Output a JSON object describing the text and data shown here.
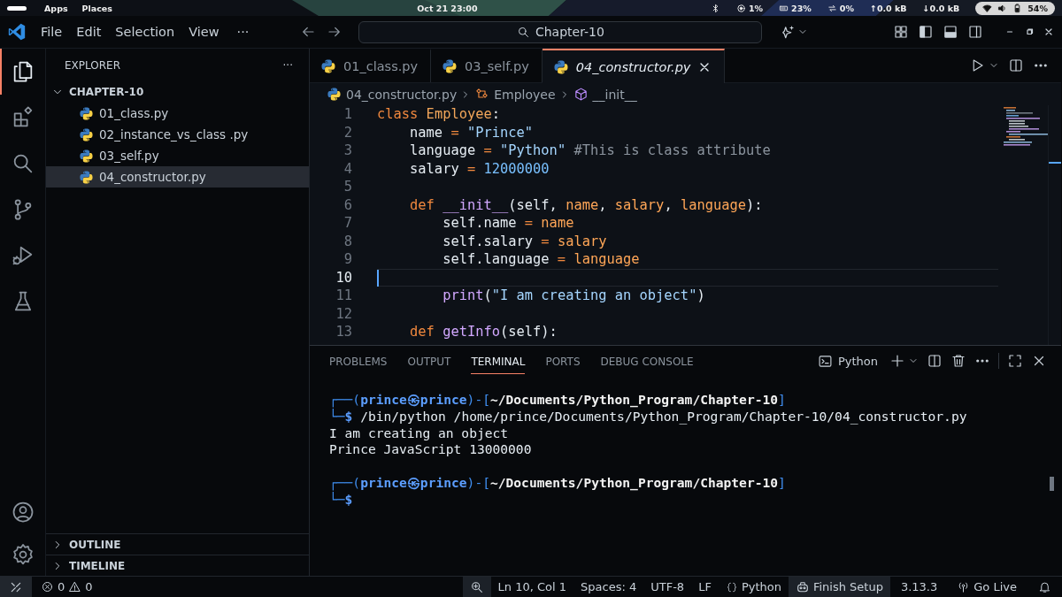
{
  "system_bar": {
    "menus": [
      "Apps",
      "Places"
    ],
    "clock": "Oct 21  23:00",
    "indicators": [
      {
        "kind": "cpu",
        "text": "1%"
      },
      {
        "kind": "memory",
        "text": "23%"
      },
      {
        "kind": "swap",
        "text": "0%"
      },
      {
        "kind": "plain",
        "text": "↑0.0 kB"
      },
      {
        "kind": "plain",
        "text": "↓0.0 kB"
      }
    ],
    "battery": "54%"
  },
  "title_bar": {
    "menus": [
      "File",
      "Edit",
      "Selection",
      "View"
    ],
    "more": "···",
    "search": {
      "value": "Chapter-10"
    }
  },
  "activity_bar": {
    "items": [
      {
        "kind": "explorer",
        "selected": true
      },
      {
        "kind": "extensions",
        "selected": false
      },
      {
        "kind": "search",
        "selected": false
      },
      {
        "kind": "source-control",
        "selected": false
      },
      {
        "kind": "run-debug",
        "selected": false
      },
      {
        "kind": "testing",
        "selected": false
      }
    ],
    "bottom": [
      {
        "kind": "account"
      },
      {
        "kind": "settings"
      }
    ]
  },
  "sidebar": {
    "title": "EXPLORER",
    "more": "···",
    "folder": {
      "label": "CHAPTER-10",
      "expanded": true,
      "children": [
        {
          "label": "01_class.py",
          "selected": false
        },
        {
          "label": "02_instance_vs_class .py",
          "selected": false
        },
        {
          "label": "03_self.py",
          "selected": false
        },
        {
          "label": "04_constructor.py",
          "selected": true
        }
      ]
    },
    "sections": [
      {
        "label": "OUTLINE",
        "expanded": false
      },
      {
        "label": "TIMELINE",
        "expanded": false
      }
    ]
  },
  "editor": {
    "tabs": [
      {
        "label": "01_class.py",
        "selected": false,
        "preview": false
      },
      {
        "label": "03_self.py",
        "selected": false,
        "preview": false
      },
      {
        "label": "04_constructor.py",
        "selected": true,
        "preview": true
      }
    ],
    "breadcrumb": [
      {
        "label": "04_constructor.py",
        "kind": "file"
      },
      {
        "label": "Employee",
        "kind": "class"
      },
      {
        "label": "__init__",
        "kind": "method"
      }
    ],
    "lines": [
      {
        "number": "1",
        "current": false,
        "tokens": [
          {
            "text": "class",
            "kind": "kw"
          },
          {
            "text": " Employee",
            "kind": "cls"
          },
          {
            "text": ":",
            "kind": "plain"
          }
        ]
      },
      {
        "number": "2",
        "current": false,
        "tokens": [
          {
            "text": "    name",
            "kind": "plain"
          },
          {
            "text": " = ",
            "kind": "op"
          },
          {
            "text": "\"Prince\"",
            "kind": "str"
          }
        ]
      },
      {
        "number": "3",
        "current": false,
        "tokens": [
          {
            "text": "    language",
            "kind": "plain"
          },
          {
            "text": " = ",
            "kind": "op"
          },
          {
            "text": "\"Python\"",
            "kind": "str"
          },
          {
            "text": " #This is class attribute",
            "kind": "cmt"
          }
        ]
      },
      {
        "number": "4",
        "current": false,
        "tokens": [
          {
            "text": "    salary",
            "kind": "plain"
          },
          {
            "text": " = ",
            "kind": "op"
          },
          {
            "text": "12000000",
            "kind": "num"
          }
        ]
      },
      {
        "number": "5",
        "current": false
      },
      {
        "number": "6",
        "current": false,
        "tokens": [
          {
            "text": "    def",
            "kind": "kw"
          },
          {
            "text": " __init__",
            "kind": "fn"
          },
          {
            "text": "(self, ",
            "kind": "plain"
          },
          {
            "text": "name",
            "kind": "param"
          },
          {
            "text": ", ",
            "kind": "plain"
          },
          {
            "text": "salary",
            "kind": "param"
          },
          {
            "text": ", ",
            "kind": "plain"
          },
          {
            "text": "language",
            "kind": "param"
          },
          {
            "text": "):",
            "kind": "plain"
          }
        ]
      },
      {
        "number": "7",
        "current": false,
        "tokens": [
          {
            "text": "        self.name",
            "kind": "plain"
          },
          {
            "text": " = ",
            "kind": "op"
          },
          {
            "text": "name",
            "kind": "param"
          }
        ]
      },
      {
        "number": "8",
        "current": false,
        "tokens": [
          {
            "text": "        self.salary",
            "kind": "plain"
          },
          {
            "text": " = ",
            "kind": "op"
          },
          {
            "text": "salary",
            "kind": "param"
          }
        ]
      },
      {
        "number": "9",
        "current": false,
        "tokens": [
          {
            "text": "        self.language",
            "kind": "plain"
          },
          {
            "text": " = ",
            "kind": "op"
          },
          {
            "text": "language",
            "kind": "param"
          }
        ]
      },
      {
        "number": "10",
        "current": true
      },
      {
        "number": "11",
        "current": false,
        "tokens": [
          {
            "text": "        print",
            "kind": "fn"
          },
          {
            "text": "(",
            "kind": "plain"
          },
          {
            "text": "\"I am creating an object\"",
            "kind": "str"
          },
          {
            "text": ")",
            "kind": "plain"
          }
        ]
      },
      {
        "number": "12",
        "current": false
      },
      {
        "number": "13",
        "current": false,
        "tokens": [
          {
            "text": "    def",
            "kind": "kw"
          },
          {
            "text": " getInfo",
            "kind": "fn"
          },
          {
            "text": "(self):",
            "kind": "plain"
          }
        ]
      }
    ]
  },
  "panel": {
    "tabs": [
      {
        "label": "PROBLEMS",
        "selected": false
      },
      {
        "label": "OUTPUT",
        "selected": false
      },
      {
        "label": "TERMINAL",
        "selected": true
      },
      {
        "label": "PORTS",
        "selected": false
      },
      {
        "label": "DEBUG CONSOLE",
        "selected": false
      }
    ],
    "terminal_name": "Python",
    "terminal_lines": [
      {
        "kind": "prompt-head",
        "segments": [
          {
            "text": "┌──(",
            "kind": "box"
          },
          {
            "text": "prince㉿prince",
            "kind": "user"
          },
          {
            "text": ")-[",
            "kind": "box"
          },
          {
            "text": "~/Documents/Python_Program/Chapter-10",
            "kind": "path"
          },
          {
            "text": "]",
            "kind": "box"
          }
        ]
      },
      {
        "kind": "prompt-input",
        "segments": [
          {
            "text": "└─",
            "kind": "box"
          },
          {
            "text": "$",
            "kind": "prompt"
          },
          {
            "text": " /bin/python /home/prince/Documents/Python_Program/Chapter-10/04_constructor.py",
            "kind": "plain"
          }
        ]
      },
      {
        "kind": "output",
        "segments": [
          {
            "text": "I am creating an object",
            "kind": "plain"
          }
        ]
      },
      {
        "kind": "output",
        "segments": [
          {
            "text": "Prince JavaScript 13000000",
            "kind": "plain"
          }
        ]
      },
      {
        "kind": "prompt-head",
        "segments": [
          {
            "text": "┌──(",
            "kind": "box"
          },
          {
            "text": "prince㉿prince",
            "kind": "user"
          },
          {
            "text": ")-[",
            "kind": "box"
          },
          {
            "text": "~/Documents/Python_Program/Chapter-10",
            "kind": "path"
          },
          {
            "text": "]",
            "kind": "box"
          }
        ]
      },
      {
        "kind": "prompt-input",
        "segments": [
          {
            "text": "└─",
            "kind": "box"
          },
          {
            "text": "$",
            "kind": "prompt"
          }
        ]
      }
    ]
  },
  "status_bar": {
    "errors": "0",
    "warnings": "0",
    "items": [
      "Ln 10, Col 1",
      "Spaces: 4",
      "UTF-8",
      "LF"
    ],
    "language": "Python",
    "copilot": "Finish Setup",
    "python_version": "3.13.3",
    "live": "Go Live"
  }
}
